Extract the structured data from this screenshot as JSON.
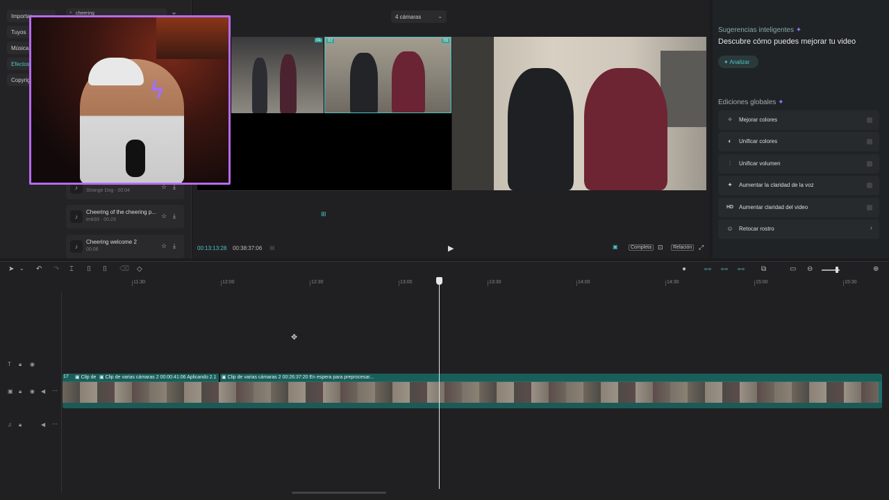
{
  "library": {
    "tabs": [
      "Importar",
      "Tuyos",
      "Música",
      "Efectos",
      "Copyright"
    ],
    "search_value": "cheering",
    "sounds": [
      {
        "title": "",
        "meta": "Strange Dog · 00:04"
      },
      {
        "title": "Cheering of the cheering p...",
        "meta": "tmk93 · 00:23"
      },
      {
        "title": "Cheering welcome 2",
        "meta": "00:08"
      }
    ]
  },
  "player": {
    "camera_select": "4 cámaras",
    "cam_tags": [
      "01",
      "02",
      "03"
    ],
    "time_current": "00:13:13:28",
    "time_total": "00:38:37:06",
    "buttons": {
      "full": "Completa",
      "ratio": "Relación"
    }
  },
  "right_panel": {
    "suggestions_heading": "Sugerencias inteligentes",
    "suggestions_title": "Descubre cómo puedes mejorar tu video",
    "analyze_label": "Analizar",
    "global_heading": "Ediciones globales",
    "edits": [
      {
        "label": "Mejorar colores",
        "icon": "wand-icon"
      },
      {
        "label": "Unificar colores",
        "icon": "palette-icon"
      },
      {
        "label": "Unificar volumen",
        "icon": "sliders-icon"
      },
      {
        "label": "Aumentar la claridad de la voz",
        "icon": "sparkle-icon"
      },
      {
        "label": "Aumentar claridad del video",
        "icon": "hd-icon"
      },
      {
        "label": "Retocar rostro",
        "icon": "face-icon"
      }
    ]
  },
  "timeline": {
    "ruler": [
      "11:30",
      "12:00",
      "12:30",
      "13:00",
      "13:30",
      "14:00",
      "14:30",
      "15:00",
      "15:30"
    ],
    "clips": [
      {
        "label": "Clip de"
      },
      {
        "label": "Clip de varias cámaras 2   00:00:41:06   Aplicando 2.1"
      },
      {
        "label": "Clip de varias cámaras 2   00:26:37:20   En espera para preprocesar..."
      }
    ],
    "clip_prefix": "17"
  }
}
